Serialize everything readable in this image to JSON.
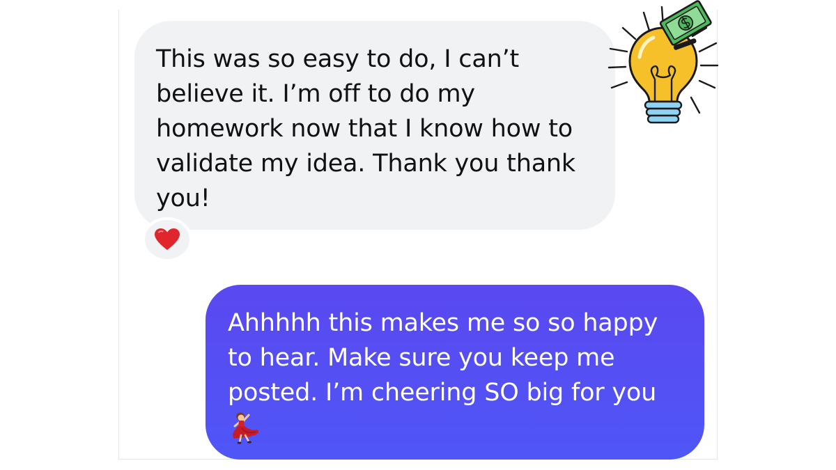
{
  "conversation": {
    "received_message": {
      "lines": [
        "This was so easy to do, I can’t",
        "believe it. I’m off to do my",
        "homework now that I know how to",
        "validate my idea. Thank you thank",
        "you!"
      ],
      "reaction": "heart-emoji"
    },
    "sent_message": {
      "lines": [
        "Ahhhhh this makes me so so happy",
        "to hear. Make sure you keep me",
        "posted. I’m cheering SO big for you"
      ],
      "trailing_emoji": "woman-dancing-emoji"
    }
  },
  "sticker": {
    "icon": "lightbulb-money-icon"
  },
  "colors": {
    "received_bubble": "#f1f2f4",
    "sent_bubble": "#5a48f0",
    "sent_text": "#ffffff",
    "received_text": "#111111",
    "heart": "#e0262c",
    "bulb": "#f5c02a",
    "money": "#4db85c"
  }
}
